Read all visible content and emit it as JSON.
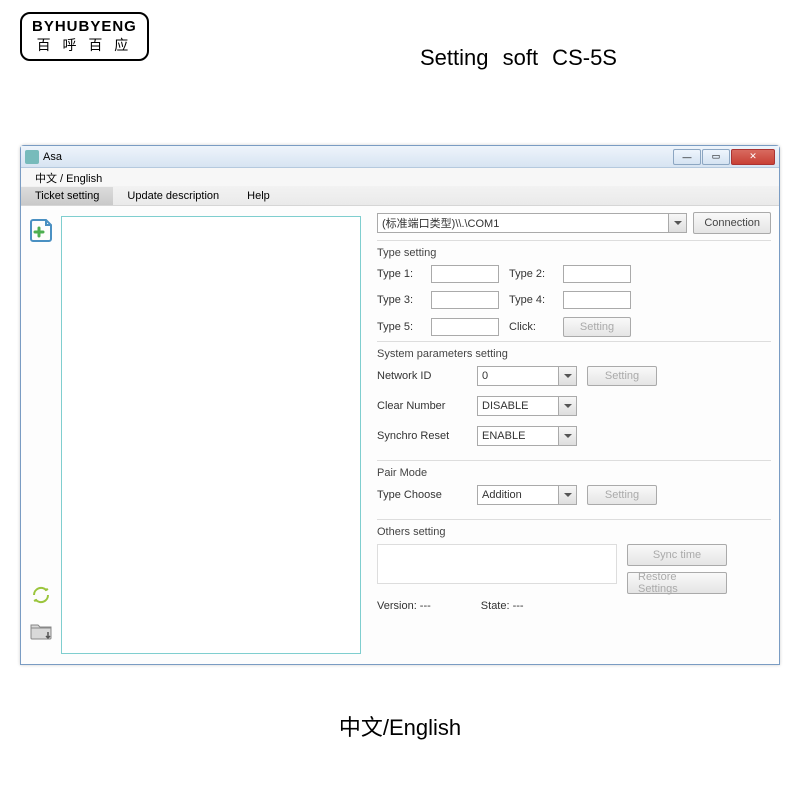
{
  "logo": {
    "en": "BYHUBYENG",
    "cn": "百 呼 百 应"
  },
  "heading": "Setting  soft  CS-5S",
  "window": {
    "title": "Asa",
    "langbar": "中文  /  English",
    "menu": {
      "ticket": "Ticket setting",
      "update": "Update description",
      "help": "Help"
    },
    "port": {
      "value": "(标准端口类型)\\\\.\\COM1",
      "connection": "Connection"
    },
    "type_setting": {
      "title": "Type setting",
      "t1": "Type 1:",
      "t2": "Type 2:",
      "t3": "Type 3:",
      "t4": "Type 4:",
      "t5": "Type 5:",
      "click": "Click:",
      "setting_btn": "Setting"
    },
    "sys_params": {
      "title": "System parameters setting",
      "network_id": "Network ID",
      "network_val": "0",
      "clear_num": "Clear Number",
      "clear_val": "DISABLE",
      "synchro": "Synchro Reset",
      "synchro_val": "ENABLE",
      "setting_btn": "Setting"
    },
    "pair_mode": {
      "title": "Pair Mode",
      "type_choose": "Type Choose",
      "type_val": "Addition",
      "setting_btn": "Setting"
    },
    "others": {
      "title": "Others setting",
      "sync": "Sync time",
      "restore": "Restore Settings",
      "version": "Version: ---",
      "state": "State: ---"
    }
  },
  "footer": "中文/English"
}
